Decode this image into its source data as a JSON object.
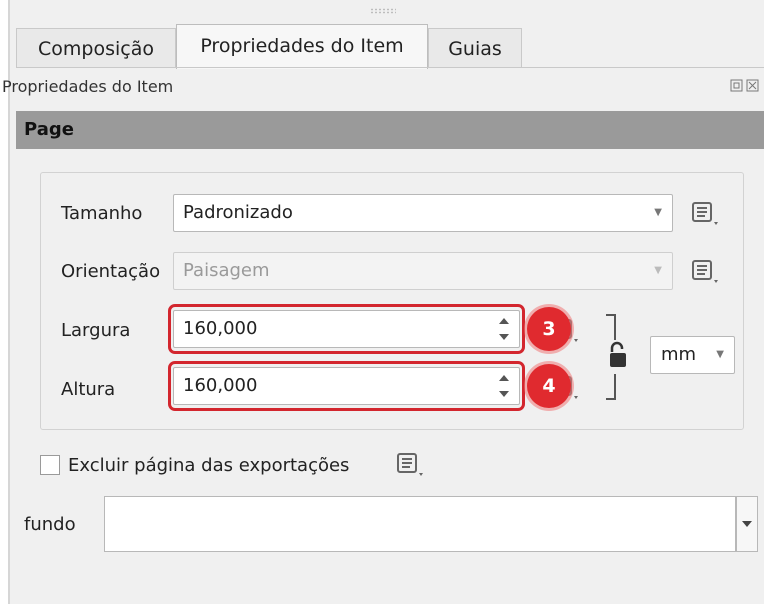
{
  "tabs": [
    {
      "label": "Composição"
    },
    {
      "label": "Propriedades do Item"
    },
    {
      "label": "Guias"
    }
  ],
  "dock": {
    "title": "Propriedades do Item"
  },
  "section": {
    "header": "Page"
  },
  "size": {
    "label": "Tamanho",
    "value": "Padronizado"
  },
  "orientation": {
    "label": "Orientação",
    "value": "Paisagem"
  },
  "width": {
    "label": "Largura",
    "value": "160,000",
    "badge": "3"
  },
  "height": {
    "label": "Altura",
    "value": "160,000",
    "badge": "4"
  },
  "units": {
    "value": "mm"
  },
  "exclude": {
    "label": "Excluir página das exportações",
    "checked": false
  },
  "background": {
    "label": "fundo",
    "value": ""
  },
  "colors": {
    "highlight": "#d3262e",
    "badge": "#e02a2f",
    "header": "#9a9a9a"
  },
  "icons": [
    "data-defined-override-icon",
    "lock-open-icon",
    "chevron-down-icon",
    "spin-arrows-icon"
  ]
}
